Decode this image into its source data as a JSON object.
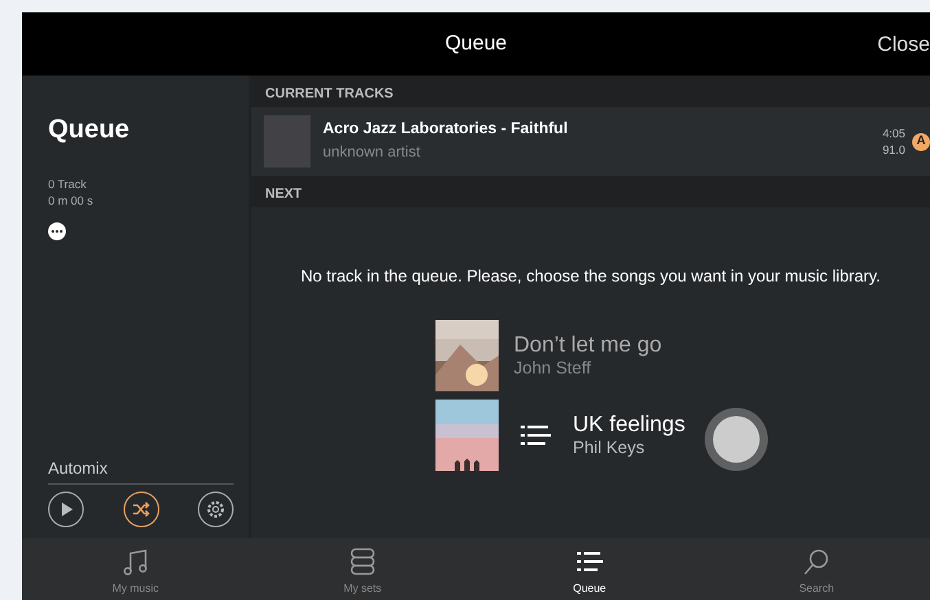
{
  "header": {
    "title": "Queue",
    "close": "Close"
  },
  "sidebar": {
    "title": "Queue",
    "track_count": "0 Track",
    "duration": "0 m 00 s",
    "automix": {
      "label": "Automix",
      "buttons": [
        {
          "kind": "play",
          "selected": false
        },
        {
          "kind": "shuffle",
          "selected": true
        },
        {
          "kind": "settings",
          "selected": false
        }
      ]
    }
  },
  "current_tracks": {
    "heading": "CURRENT TRACKS",
    "tracks": [
      {
        "title": "Acro Jazz Laboratories - Faithful",
        "artist": "unknown artist",
        "duration": "4:05",
        "bpm": "91.0",
        "deck": "A"
      }
    ]
  },
  "next": {
    "heading": "NEXT",
    "empty_message": "No track in the queue. Please, choose the songs you want in your music library.",
    "suggestions": [
      {
        "title": "Don’t let me go",
        "artist": "John Steff",
        "dragging": false
      },
      {
        "title": "UK feelings",
        "artist": "Phil Keys",
        "dragging": true
      }
    ]
  },
  "tab_bar": [
    {
      "label": "My music",
      "kind": "music",
      "selected": false
    },
    {
      "label": "My sets",
      "kind": "sets",
      "selected": false
    },
    {
      "label": "Queue",
      "kind": "queue",
      "selected": true
    },
    {
      "label": "Search",
      "kind": "search",
      "selected": false
    }
  ]
}
